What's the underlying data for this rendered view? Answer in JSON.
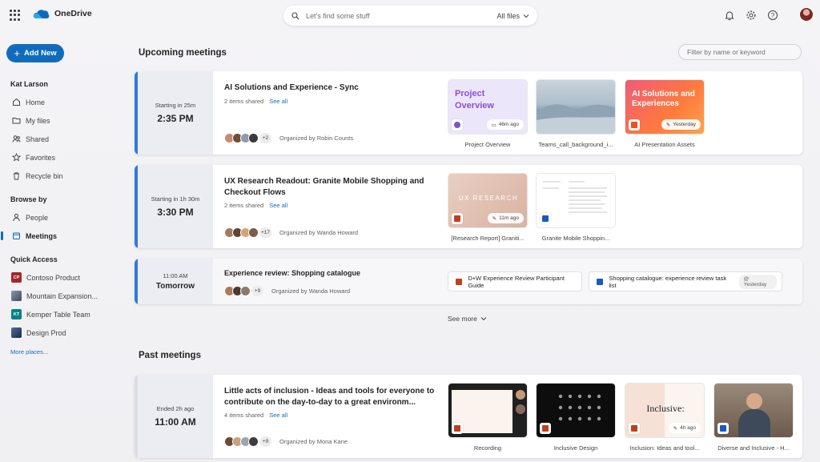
{
  "app": {
    "name": "OneDrive"
  },
  "search": {
    "placeholder": "Let's find some stuff",
    "scope": "All files"
  },
  "sidebar": {
    "add_new": "Add New",
    "user": "Kat Larson",
    "items": [
      {
        "label": "Home",
        "icon": "home-icon"
      },
      {
        "label": "My files",
        "icon": "folder-icon"
      },
      {
        "label": "Shared",
        "icon": "people-icon"
      },
      {
        "label": "Favorites",
        "icon": "star-icon"
      },
      {
        "label": "Recycle bin",
        "icon": "trash-icon"
      }
    ],
    "browse_by": "Browse by",
    "browse_items": [
      {
        "label": "People",
        "icon": "person-icon"
      },
      {
        "label": "Meetings",
        "icon": "calendar-icon",
        "active": true
      }
    ],
    "quick_access": "Quick Access",
    "quick_items": [
      {
        "label": "Contoso Product",
        "badge": "CP",
        "color": "#a4262c"
      },
      {
        "label": "Mountain Expansion...",
        "badge": "",
        "color": "#5c6a7a"
      },
      {
        "label": "Kemper Table Team",
        "badge": "KT",
        "color": "#038387"
      },
      {
        "label": "Design Prod",
        "badge": "",
        "color": "#2b3a55"
      }
    ],
    "more_places": "More places..."
  },
  "upcoming": {
    "title": "Upcoming meetings",
    "filter_placeholder": "Filter by name or keyword",
    "meetings": [
      {
        "when_label": "Starting in 25m",
        "time": "2:35 PM",
        "title": "AI Solutions and Experience - Sync",
        "shared": "2 items shared",
        "see_all": "See all",
        "more": "+2",
        "organizer": "Organized by Robin Counts",
        "files": [
          {
            "caption": "Project Overview",
            "text": "Project Overview",
            "chip": "46m ago"
          },
          {
            "caption": "Teams_call_background_i..."
          },
          {
            "caption": "AI Presentation Assets",
            "text": "AI Solutions and Experiences",
            "chip": "Yesterday"
          }
        ]
      },
      {
        "when_label": "Starting in 1h 30m",
        "time": "3:30 PM",
        "title": "UX Research Readout: Granite Mobile Shopping and Checkout Flows",
        "shared": "2 items shared",
        "see_all": "See all",
        "more": "+17",
        "organizer": "Organized by Wanda Howard",
        "files": [
          {
            "caption": "[Research Report] Graniti...",
            "text": "UX RESEARCH",
            "chip": "11m ago"
          },
          {
            "caption": "Granite Mobile Shoppin..."
          }
        ]
      },
      {
        "when_label": "11:00 AM",
        "time": "Tomorrow",
        "title": "Experience review: Shopping catalogue",
        "more": "+9",
        "organizer": "Organized by Wanda Howard",
        "files": [
          {
            "caption": "D+W Experience Review Participant Guide"
          },
          {
            "caption": "Shopping catalogue: experience review task list",
            "chip": "Yesterday"
          }
        ]
      }
    ],
    "see_more": "See more"
  },
  "past": {
    "title": "Past meetings",
    "meetings": [
      {
        "when_label": "Ended 2h ago",
        "time": "11:00 AM",
        "title": "Little acts of inclusion - Ideas and tools for everyone to contribute on the day-to-day to a great environm...",
        "shared": "4 items shared",
        "see_all": "See all",
        "more": "+9",
        "organizer": "Organized by Mona Kane",
        "files": [
          {
            "caption": "Recording"
          },
          {
            "caption": "Inclusive Design"
          },
          {
            "caption": "Inclusion: Ideas and tool...",
            "text": "Inclusive:",
            "chip": "4h ago"
          },
          {
            "caption": "Diverse and Inclusive - H..."
          }
        ]
      }
    ]
  },
  "colors": {
    "accent": "#0f6cbd",
    "meeting_bar": "#2f7ad9"
  }
}
